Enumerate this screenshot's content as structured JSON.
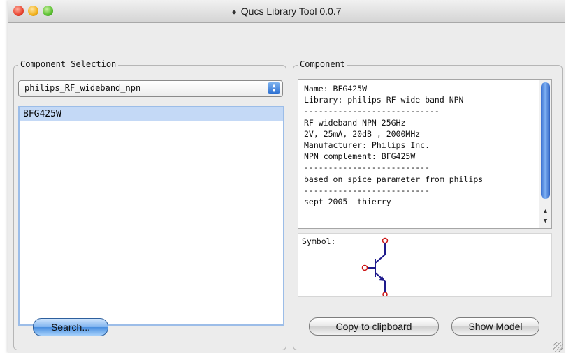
{
  "window": {
    "title": "Qucs Library Tool 0.0.7"
  },
  "component_selection": {
    "label": "Component Selection",
    "library_select": {
      "value": "philips_RF_wideband_npn"
    },
    "items": [
      "BFG425W"
    ],
    "search_label": "Search..."
  },
  "component": {
    "label": "Component",
    "lines": [
      "Name: BFG425W",
      "Library: philips RF wide band NPN",
      "----------------------------",
      "RF wideband NPN 25GHz",
      "2V, 25mA, 20dB , 2000MHz",
      "Manufacturer: Philips Inc.",
      "NPN complement: BFG425W",
      "--------------------------",
      "based on spice parameter from philips",
      "--------------------------",
      "sept 2005  thierry"
    ],
    "symbol_label": "Symbol:",
    "copy_label": "Copy to clipboard",
    "show_model_label": "Show Model"
  },
  "colors": {
    "selection": "#c4d9f6",
    "symbol_line": "#1e1a8c",
    "symbol_port": "#cc1414"
  }
}
